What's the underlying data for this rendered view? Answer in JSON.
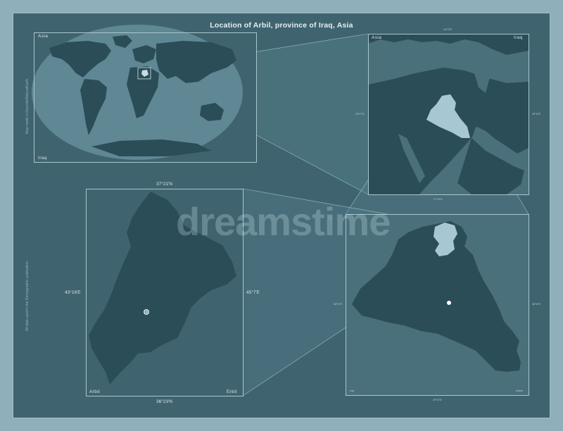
{
  "title": "Location of Arbil, province of Iraq, Asia",
  "world_panel": {
    "top_label": "Asia",
    "bottom_label": "Iraq",
    "side_note": "Map made in Keynote/NaturalEarth"
  },
  "region_panel": {
    "top_left_label": "Asia",
    "top_right_label": "Iraq",
    "top_coord": "44°13'E",
    "left_coord": "33°47'N",
    "right_coord": "49°19'E",
    "bottom_coord": "27°15'N"
  },
  "arbil_panel": {
    "top_coord": "37°21'N",
    "bottom_coord": "36°23'N",
    "left_coord": "43°16'E",
    "right_coord": "45°7'E",
    "bottom_left_label": "Arbil",
    "bottom_right_label": "Erbil",
    "side_note": "All data used in the Demographic publication"
  },
  "iraq_panel": {
    "left_coord": "38°47'E",
    "right_coord": "48°39'E",
    "bottom_coord": "29°03'N",
    "bottom_left_label": "Iraq",
    "bottom_right_label": "Arabia"
  },
  "watermark": {
    "text": "dreamstime",
    "sub": "®"
  },
  "colors": {
    "background": "#8fb0bb",
    "frame": "#3f6470",
    "land": "#2b4d58",
    "sea": "#4a707b",
    "highlight": "#a7c8d2"
  }
}
